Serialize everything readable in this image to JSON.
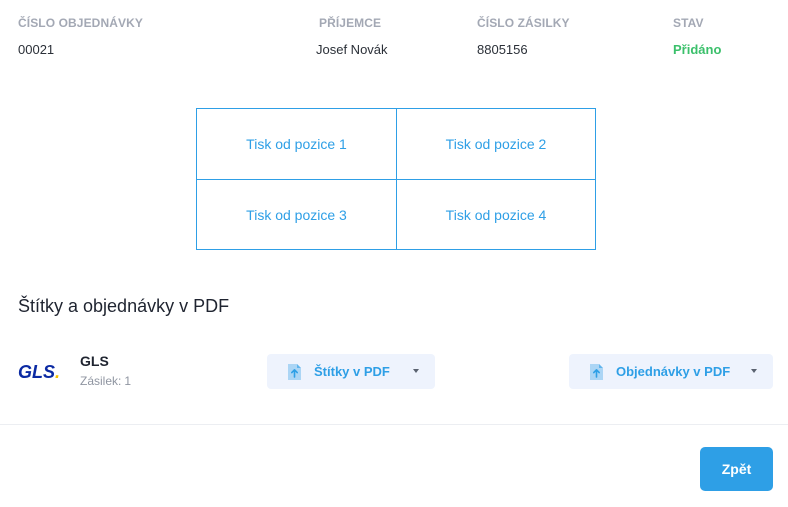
{
  "order": {
    "number_label": "ČÍSLO OBJEDNÁVKY",
    "number_value": "00021",
    "recipient_label": "PŘÍJEMCE",
    "recipient_value": "Josef Novák",
    "parcel_label": "ČÍSLO ZÁSILKY",
    "parcel_value": "8805156",
    "status_label": "STAV",
    "status_value": "Přidáno",
    "status_color": "#3bc06b"
  },
  "positions": [
    "Tisk od pozice 1",
    "Tisk od pozice 2",
    "Tisk od pozice 3",
    "Tisk od pozice 4"
  ],
  "section": {
    "title": "Štítky a objednávky v PDF"
  },
  "carrier": {
    "logo_text": "GLS.",
    "name": "GLS",
    "count_label": "Zásilek:",
    "count_value": "1"
  },
  "buttons": {
    "labels_pdf": "Štítky v PDF",
    "orders_pdf": "Objednávky v PDF",
    "back": "Zpět"
  },
  "icons": {
    "file_upload": "file-upload-icon",
    "caret": "caret-down-icon"
  },
  "colors": {
    "accent": "#2e9fe6",
    "gls_blue": "#0b2aa3",
    "gls_yellow": "#f7c300"
  }
}
